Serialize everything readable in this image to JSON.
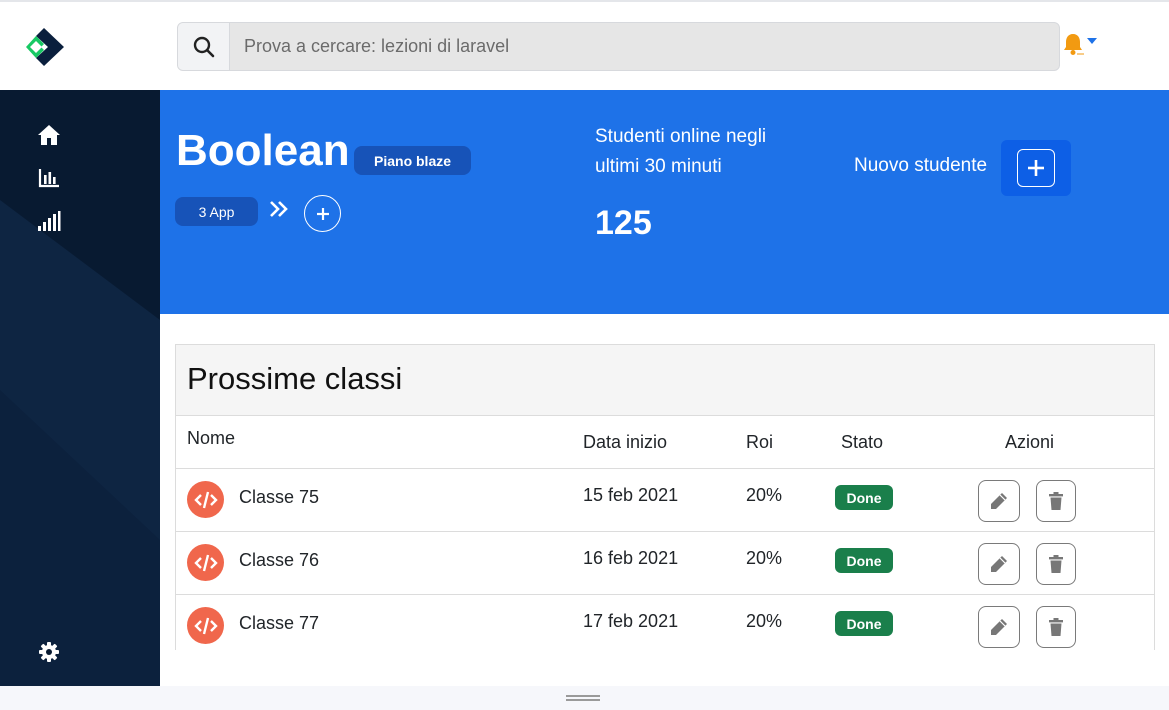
{
  "search": {
    "placeholder": "Prova a cercare: lezioni di laravel"
  },
  "colors": {
    "accent": "#1e72e8",
    "sidebar": "#081a31",
    "status_done": "#1a7f4b",
    "class_icon": "#f0674c",
    "bell": "#f29a11"
  },
  "icons": {
    "logo": "diamond-logo-icon",
    "search": "search-icon",
    "notifications": "bell-icon",
    "sidebar": [
      "home-icon",
      "bar-chart-icon",
      "signal-icon",
      "gear-icon"
    ]
  },
  "hero": {
    "title": "Boolean",
    "plan": "Piano blaze",
    "apps": "3 App",
    "online_label": "Studenti online negli ultimi 30 minuti",
    "online_count": "125",
    "new_student_label": "Nuovo studente"
  },
  "classes": {
    "title": "Prossime classi",
    "headers": {
      "name": "Nome",
      "start": "Data inizio",
      "roi": "Roi",
      "status": "Stato",
      "actions": "Azioni"
    },
    "rows": [
      {
        "name": "Classe 75",
        "start": "15 feb 2021",
        "roi": "20%",
        "status": "Done"
      },
      {
        "name": "Classe 76",
        "start": "16 feb 2021",
        "roi": "20%",
        "status": "Done"
      },
      {
        "name": "Classe 77",
        "start": "17 feb 2021",
        "roi": "20%",
        "status": "Done"
      }
    ]
  }
}
